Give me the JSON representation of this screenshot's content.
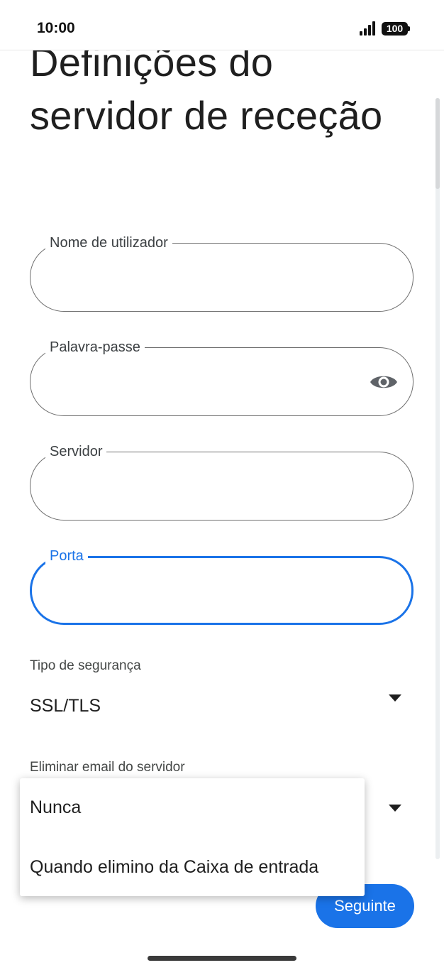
{
  "status_bar": {
    "time": "10:00",
    "battery": "100"
  },
  "page": {
    "title": "Definições do servidor de receção"
  },
  "fields": [
    {
      "label": "Nome de utilizador",
      "value": ""
    },
    {
      "label": "Palavra-passe",
      "value": ""
    },
    {
      "label": "Servidor",
      "value": ""
    },
    {
      "label": "Porta",
      "value": "",
      "focused": true
    }
  ],
  "icons": {
    "password_toggle": "eye-icon",
    "dropdown_arrow": "triangle-down-icon"
  },
  "security": {
    "label": "Tipo de segurança",
    "value": "SSL/TLS"
  },
  "delete_email": {
    "label": "Eliminar email do servidor",
    "options": [
      "Nunca",
      "Quando elimino da Caixa de entrada"
    ]
  },
  "actions": {
    "next_label": "Seguinte"
  },
  "colors": {
    "accent": "#1a73e8",
    "outline": "#6f6f6f",
    "text": "#1f1f1f"
  }
}
